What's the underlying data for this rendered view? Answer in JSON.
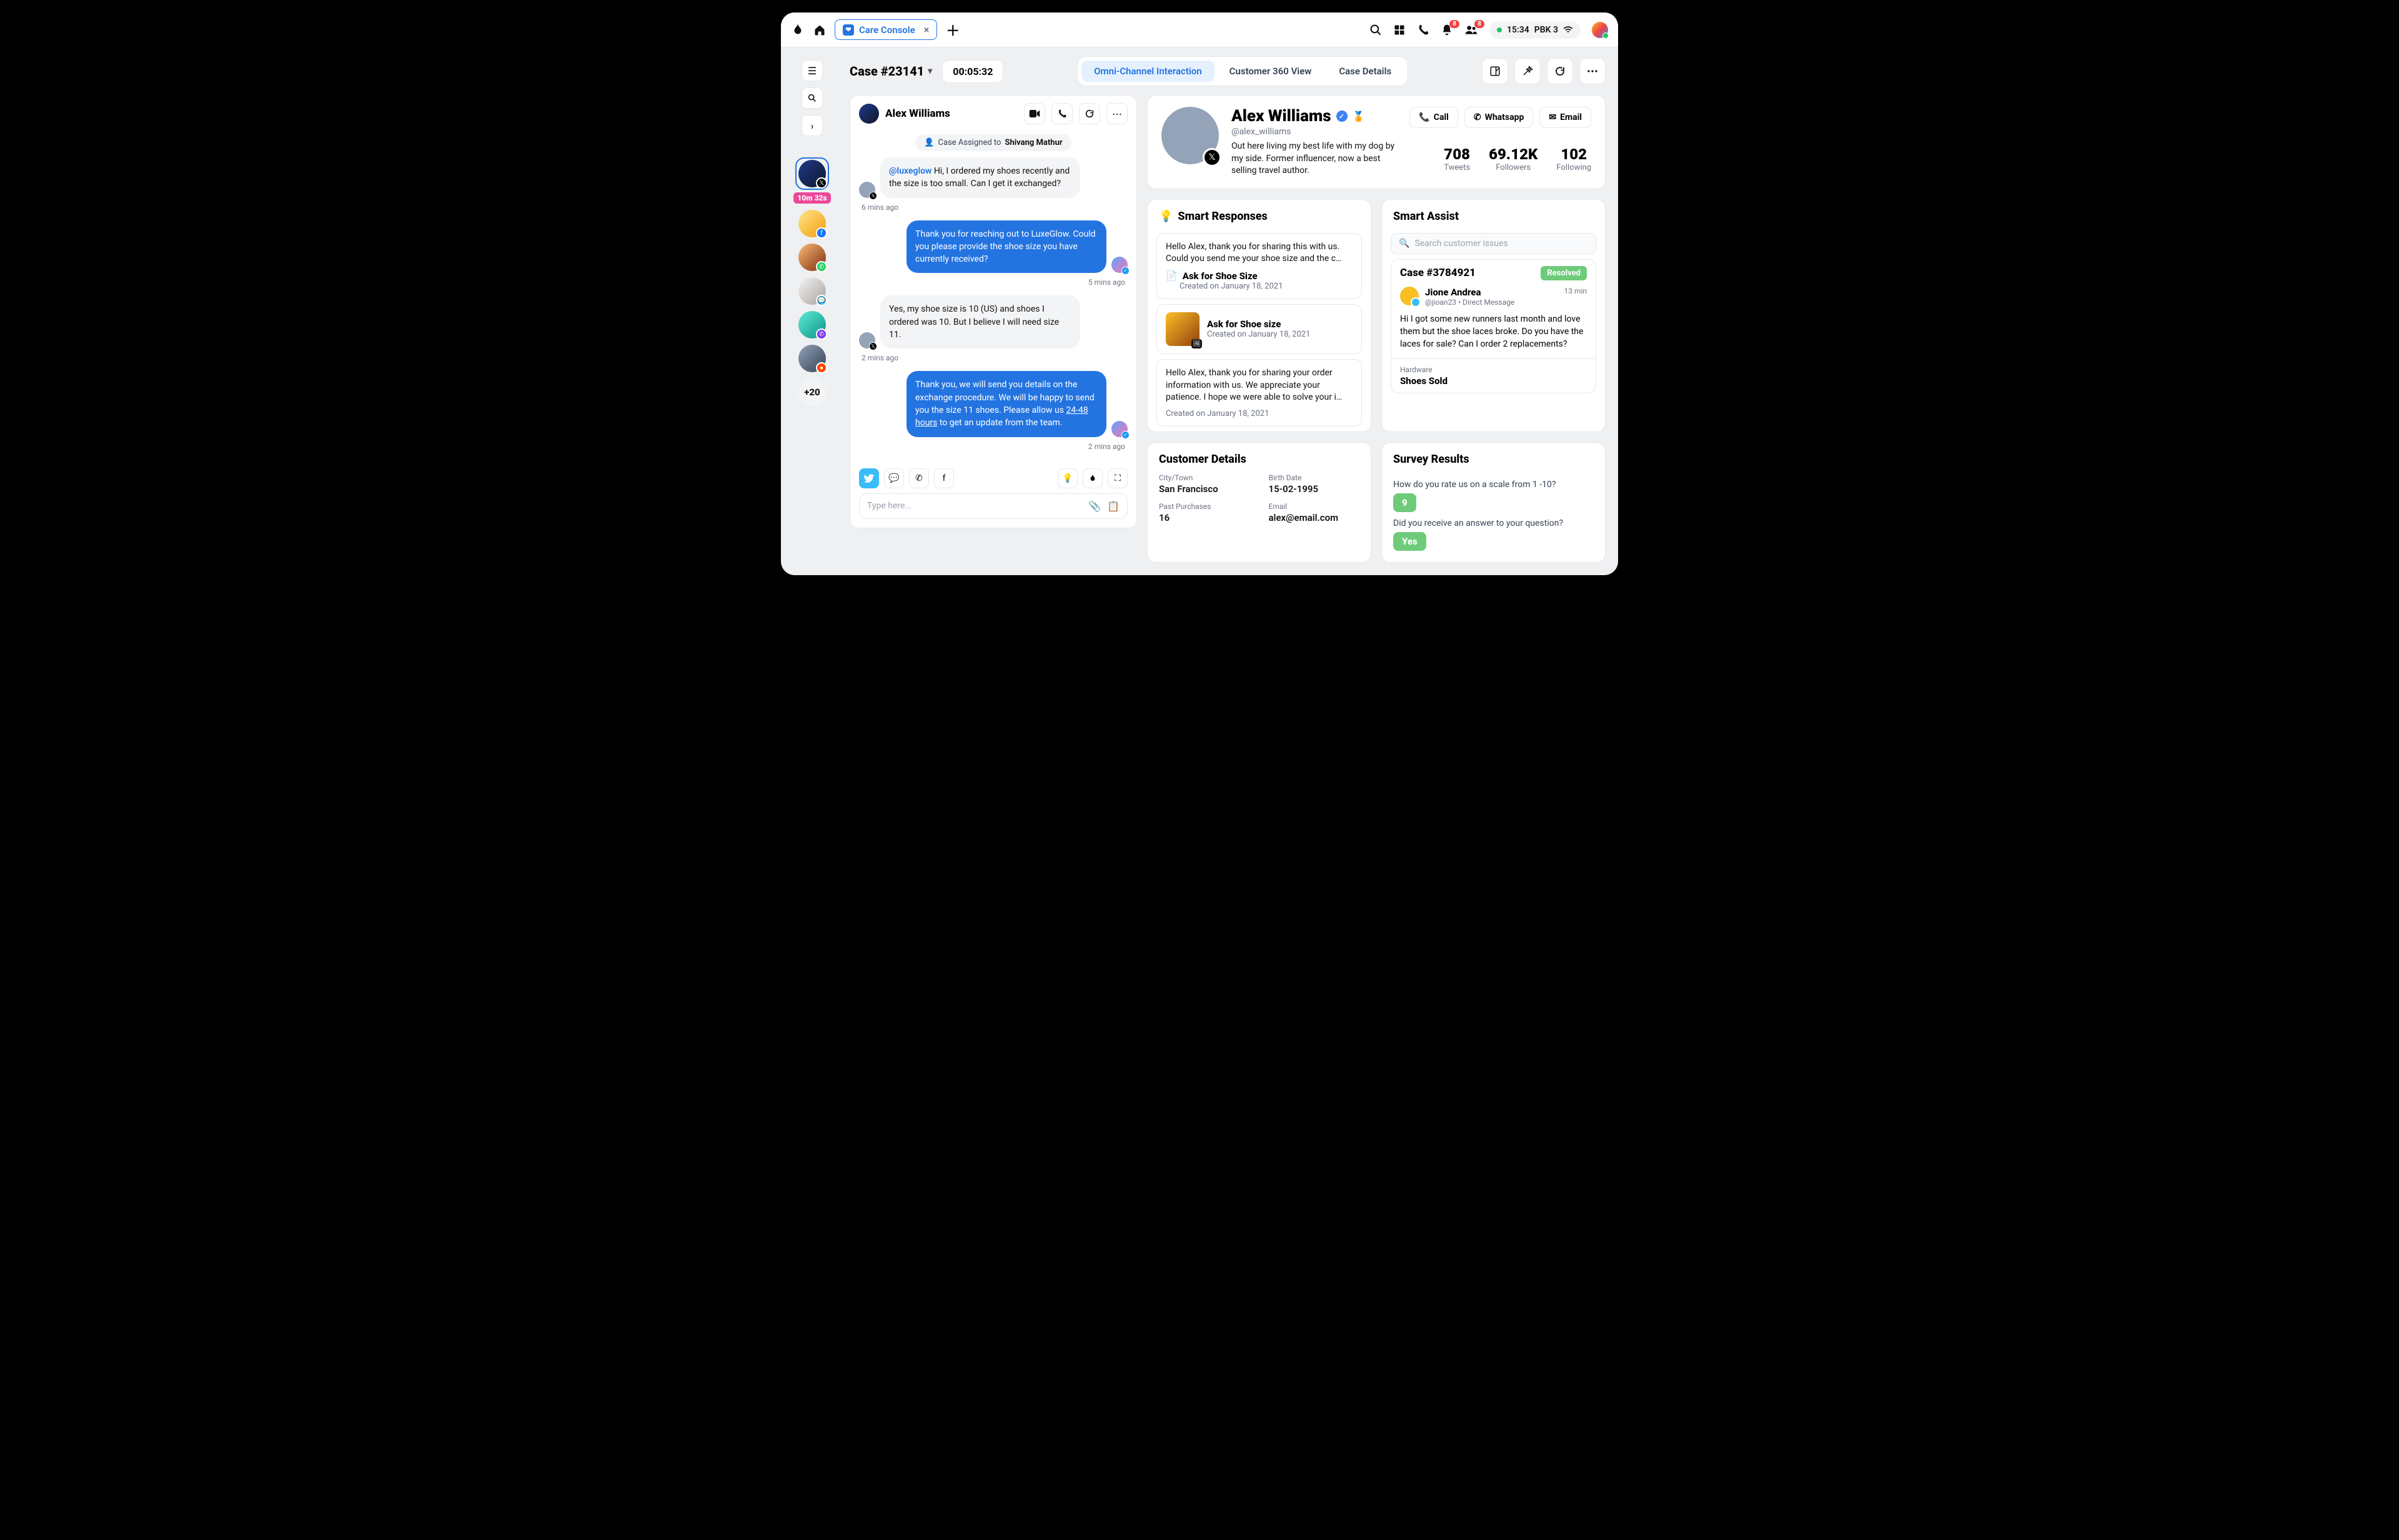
{
  "topbar": {
    "tab_label": "Care Console",
    "notif_badge": "8",
    "people_badge": "8",
    "time": "15:34",
    "workspace": "PBK 3"
  },
  "subhead": {
    "case_title": "Case #23141",
    "timer": "00:05:32",
    "tabs": [
      "Omni-Channel Interaction",
      "Customer 360 View",
      "Case Details"
    ]
  },
  "rail": {
    "active_timer": "10m 32s",
    "more_count": "+20"
  },
  "chat": {
    "header_name": "Alex Williams",
    "assigned_prefix": "Case Assigned to ",
    "assigned_to": "Shivang Mathur",
    "messages": [
      {
        "dir": "in",
        "mention": "@luxeglow",
        "text": " Hi, I ordered my shoes recently and the size is too small. Can I get it exchanged?",
        "ts": "6 mins ago"
      },
      {
        "dir": "out",
        "text": "Thank you for reaching out to LuxeGlow. Could you please provide the shoe size you have currently received?",
        "ts": "5 mins ago"
      },
      {
        "dir": "in",
        "text": "Yes, my shoe size is 10 (US) and shoes I ordered was 10. But I believe I will need size 11.",
        "ts": "2 mins ago"
      },
      {
        "dir": "out",
        "text_a": "Thank you, we will send you details on the exchange procedure. We will be happy to send you the size 11 shoes. Please allow us ",
        "ul": "24-48 hours",
        "text_b": " to get an update from the team.",
        "ts": "2 mins ago"
      }
    ],
    "compose_placeholder": "Type here..."
  },
  "profile": {
    "name": "Alex Williams",
    "handle": "@alex_williams",
    "bio": "Out here living my best life with my dog by my side. Former influencer, now a best selling travel author.",
    "contact": {
      "call": "Call",
      "whatsapp": "Whatsapp",
      "email": "Email"
    },
    "stats": [
      {
        "n": "708",
        "l": "Tweets"
      },
      {
        "n": "69.12K",
        "l": "Followers"
      },
      {
        "n": "102",
        "l": "Following"
      }
    ]
  },
  "smart_responses": {
    "title": "Smart Responses",
    "items": [
      {
        "text": "Hello Alex, thank you for sharing this with us. Could you send me your shoe size and the c…",
        "title": "Ask for Shoe Size",
        "sub": "Created on January 18, 2021"
      },
      {
        "title": "Ask for Shoe size",
        "sub": "Created on January 18, 2021"
      },
      {
        "text": "Hello Alex, thank you for sharing your order information with us. We appreciate your patience. I hope we were able to solve your i…",
        "sub": "Created on January 18, 2021"
      }
    ]
  },
  "smart_assist": {
    "title": "Smart Assist",
    "search_ph": "Search customer issues",
    "case": {
      "id": "Case #3784921",
      "status": "Resolved",
      "user": "Jione Andrea",
      "handle": "@jioan23 • Direct Message",
      "time": "13 min",
      "text": "Hi I got some new runners last month and love them but the shoe laces broke. Do you have the laces for sale? Can I order 2 replacements?"
    },
    "hardware_label": "Hardware",
    "hardware_value": "Shoes Sold"
  },
  "customer_details": {
    "title": "Customer Details",
    "fields": [
      {
        "lbl": "City/Town",
        "val": "San Francisco"
      },
      {
        "lbl": "Birth Date",
        "val": "15-02-1995"
      },
      {
        "lbl": "Past Purchases",
        "val": "16"
      },
      {
        "lbl": "Email",
        "val": "alex@email.com"
      }
    ]
  },
  "survey": {
    "title": "Survey Results",
    "q1": "How do you rate us on a scale from 1 -10?",
    "a1": "9",
    "q2": "Did you receive an answer to your question?",
    "a2": "Yes"
  }
}
